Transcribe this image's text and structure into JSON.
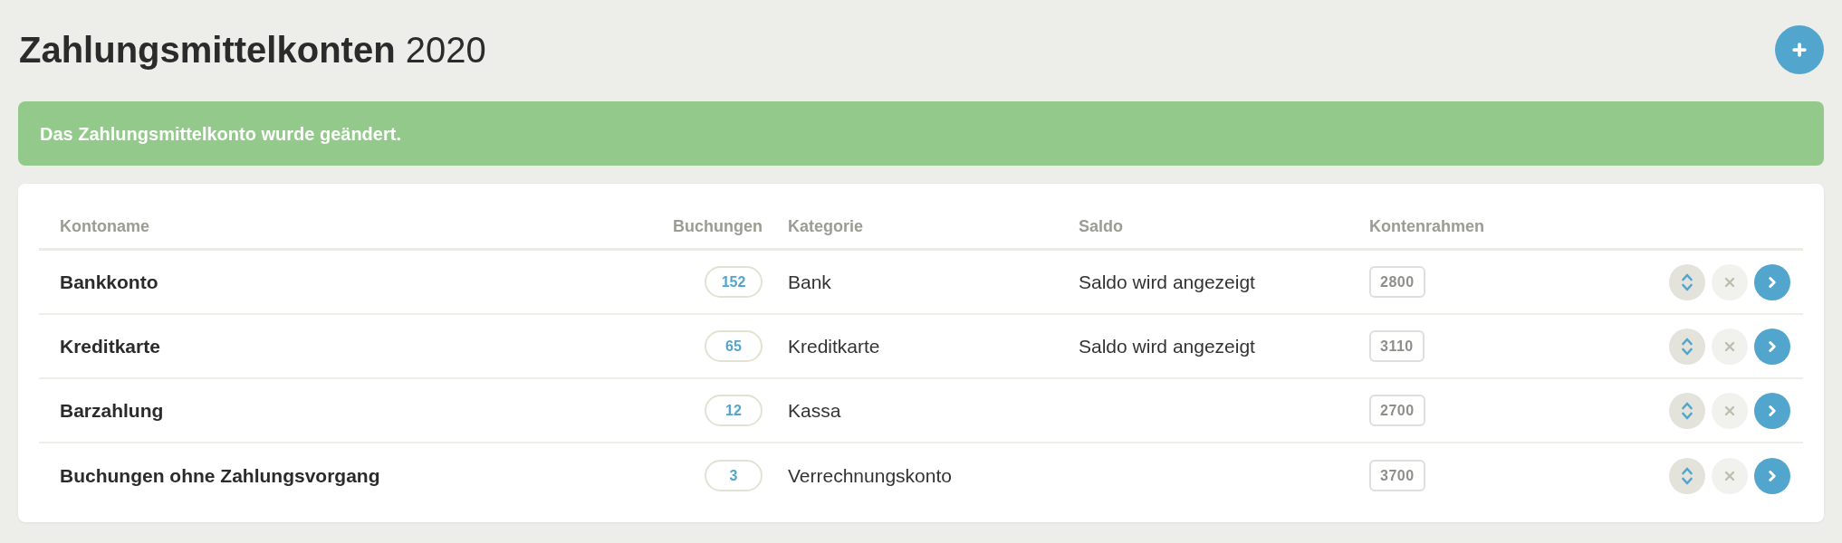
{
  "page": {
    "title": "**Zahlungsmittelkonten** 2020"
  },
  "alert": {
    "message": "Das Zahlungsmittelkonto wurde geändert."
  },
  "table": {
    "columns": [
      "Kontoname",
      "Buchungen",
      "Kategorie",
      "Saldo",
      "Kontenrahmen"
    ],
    "rows": [
      {
        "name": "Bankkonto",
        "bookings": "152",
        "category": "Bank",
        "balance": "Saldo wird angezeigt",
        "account_number": "2800"
      },
      {
        "name": "Kreditkarte",
        "bookings": "65",
        "category": "Kreditkarte",
        "balance": "Saldo wird angezeigt",
        "account_number": "3110"
      },
      {
        "name": "Barzahlung",
        "bookings": "12",
        "category": "Kassa",
        "account_number": "2700"
      },
      {
        "name": "Buchungen ohne Zahlungsvorgang",
        "bookings": "3",
        "category": "Verrechnungskonto",
        "account_number": "3700"
      }
    ]
  }
}
